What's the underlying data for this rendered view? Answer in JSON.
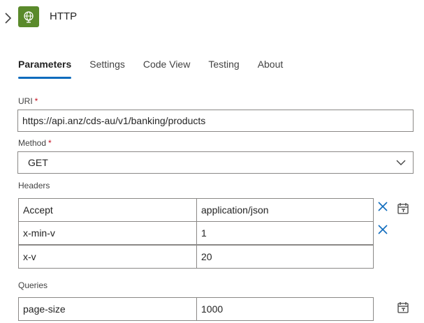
{
  "header": {
    "title": "HTTP",
    "icons": {
      "expand": "chevron-right-icon",
      "action": "globe-icon"
    },
    "accent_color": "#5a8a2b"
  },
  "tabs": [
    {
      "label": "Parameters",
      "active": true
    },
    {
      "label": "Settings",
      "active": false
    },
    {
      "label": "Code View",
      "active": false
    },
    {
      "label": "Testing",
      "active": false
    },
    {
      "label": "About",
      "active": false
    }
  ],
  "uri": {
    "label": "URI",
    "required_mark": "*",
    "value": "https://api.anz/cds-au/v1/banking/products"
  },
  "method": {
    "label": "Method",
    "required_mark": "*",
    "value": "GET"
  },
  "headers": {
    "label": "Headers",
    "rows": [
      {
        "key": "Accept",
        "value": "application/json"
      },
      {
        "key": "x-min-v",
        "value": "1"
      },
      {
        "key": "x-v",
        "value": "20"
      }
    ]
  },
  "queries": {
    "label": "Queries",
    "rows": [
      {
        "key": "page-size",
        "value": "1000"
      }
    ]
  },
  "colors": {
    "tab_underline": "#0f6cbd",
    "delete_icon": "#0f6cbd",
    "required": "#c50f1f"
  }
}
